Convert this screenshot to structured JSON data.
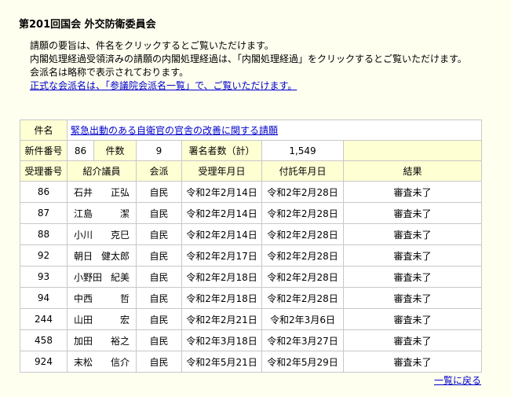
{
  "page_title": "第201回国会 外交防衛委員会",
  "intro": {
    "line1": "請願の要旨は、件名をクリックするとご覧いただけます。",
    "line2": "内閣処理経過受領済みの請願の内閣処理経過は、「内閣処理経過」をクリックするとご覧いただけます。",
    "line3": "会派名は略称で表示されております。",
    "link": "正式な会派名は、「参議院会派名一覧」で、ご覧いただけます。"
  },
  "petition": {
    "subject_label": "件名",
    "subject": "緊急出動のある自衛官の官舎の改善に関する請願",
    "new_number_label": "新件番号",
    "new_number": "86",
    "count_label": "件数",
    "count": "9",
    "signatures_label": "署名者数（計）",
    "signatures": "1,549"
  },
  "table": {
    "headers": [
      "受理番号",
      "紹介議員",
      "会派",
      "受理年月日",
      "付託年月日",
      "結果"
    ],
    "rows": [
      {
        "no": "86",
        "surname": "石井",
        "given": "正弘",
        "party": "自民",
        "received": "令和2年2月14日",
        "referred": "令和2年2月28日",
        "result": "審査未了"
      },
      {
        "no": "87",
        "surname": "江島",
        "given": "潔",
        "party": "自民",
        "received": "令和2年2月14日",
        "referred": "令和2年2月28日",
        "result": "審査未了"
      },
      {
        "no": "88",
        "surname": "小川",
        "given": "克巳",
        "party": "自民",
        "received": "令和2年2月14日",
        "referred": "令和2年2月28日",
        "result": "審査未了"
      },
      {
        "no": "92",
        "surname": "朝日",
        "given": "健太郎",
        "party": "自民",
        "received": "令和2年2月17日",
        "referred": "令和2年2月28日",
        "result": "審査未了"
      },
      {
        "no": "93",
        "surname": "小野田",
        "given": "紀美",
        "party": "自民",
        "received": "令和2年2月18日",
        "referred": "令和2年2月28日",
        "result": "審査未了"
      },
      {
        "no": "94",
        "surname": "中西",
        "given": "哲",
        "party": "自民",
        "received": "令和2年2月18日",
        "referred": "令和2年2月28日",
        "result": "審査未了"
      },
      {
        "no": "244",
        "surname": "山田",
        "given": "宏",
        "party": "自民",
        "received": "令和2年2月21日",
        "referred": "令和2年3月6日",
        "result": "審査未了"
      },
      {
        "no": "458",
        "surname": "加田",
        "given": "裕之",
        "party": "自民",
        "received": "令和2年3月18日",
        "referred": "令和2年3月27日",
        "result": "審査未了"
      },
      {
        "no": "924",
        "surname": "末松",
        "given": "信介",
        "party": "自民",
        "received": "令和2年5月21日",
        "referred": "令和2年5月29日",
        "result": "審査未了"
      }
    ]
  },
  "back_link": "一覧に戻る"
}
